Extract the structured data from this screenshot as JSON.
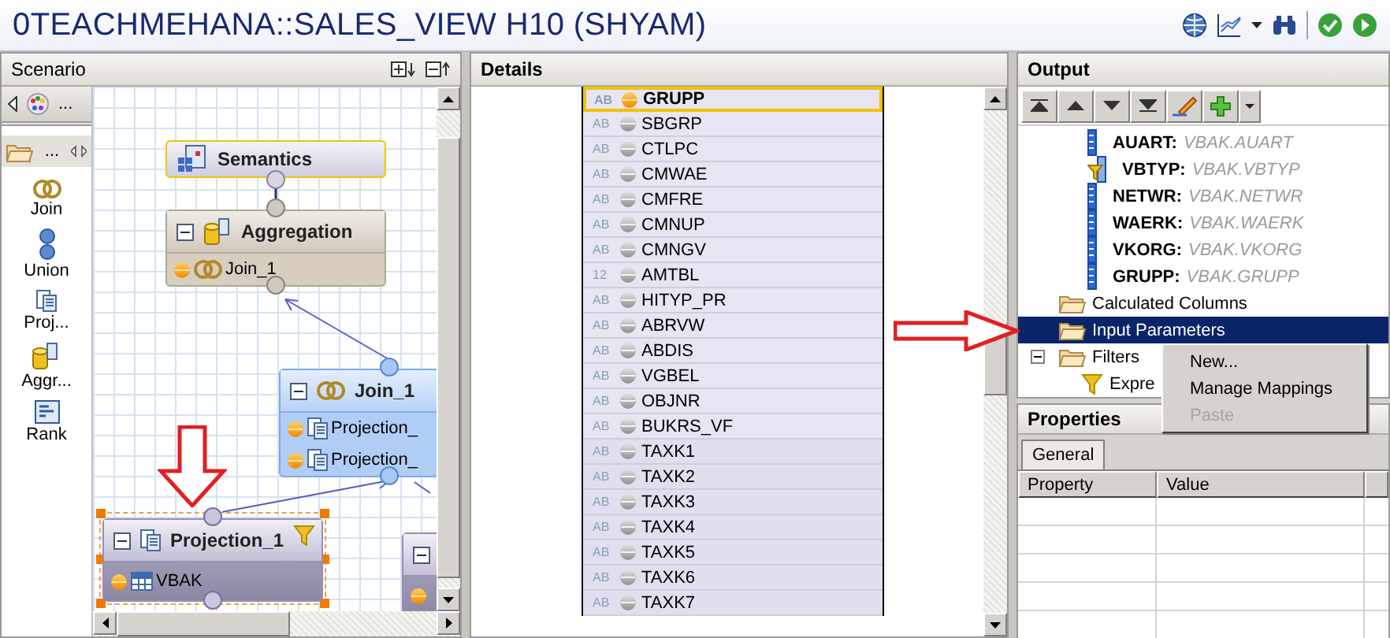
{
  "window": {
    "title": "0TEACHMEHANA::SALES_VIEW H10 (SHYAM)"
  },
  "scenario": {
    "title": "Scenario",
    "palette": {
      "top_label": "...",
      "folder_label": "...",
      "items": [
        {
          "label": "Join",
          "kind": "join"
        },
        {
          "label": "Union",
          "kind": "union"
        },
        {
          "label": "Proj...",
          "kind": "projection"
        },
        {
          "label": "Aggr...",
          "kind": "aggregation"
        },
        {
          "label": "Rank",
          "kind": "rank"
        }
      ]
    },
    "nodes": [
      {
        "kind": "semantics",
        "title": "Semantics",
        "selected": false
      },
      {
        "kind": "aggregation",
        "title": "Aggregation",
        "selected": false,
        "inputs": [
          {
            "kind": "join",
            "label": "Join_1"
          }
        ]
      },
      {
        "kind": "join",
        "title": "Join_1",
        "selected": false,
        "inputs": [
          {
            "kind": "projection",
            "label": "Projection_"
          },
          {
            "kind": "projection",
            "label": "Projection_"
          }
        ]
      },
      {
        "kind": "projection",
        "title": "Projection_1",
        "selected": true,
        "filtered": true,
        "inputs": [
          {
            "kind": "table",
            "label": "VBAK"
          }
        ]
      },
      {
        "kind": "projection",
        "selected": false,
        "inputs": [
          {
            "kind": "blank"
          }
        ]
      }
    ]
  },
  "details": {
    "title": "Details",
    "fields": [
      {
        "type": "AB",
        "name": "GRUPP",
        "selected": true
      },
      {
        "type": "AB",
        "name": "SBGRP",
        "selected": false
      },
      {
        "type": "AB",
        "name": "CTLPC",
        "selected": false
      },
      {
        "type": "AB",
        "name": "CMWAE",
        "selected": false
      },
      {
        "type": "AB",
        "name": "CMFRE",
        "selected": false
      },
      {
        "type": "AB",
        "name": "CMNUP",
        "selected": false
      },
      {
        "type": "AB",
        "name": "CMNGV",
        "selected": false
      },
      {
        "type": "12",
        "name": "AMTBL",
        "selected": false
      },
      {
        "type": "AB",
        "name": "HITYP_PR",
        "selected": false
      },
      {
        "type": "AB",
        "name": "ABRVW",
        "selected": false
      },
      {
        "type": "AB",
        "name": "ABDIS",
        "selected": false
      },
      {
        "type": "AB",
        "name": "VGBEL",
        "selected": false
      },
      {
        "type": "AB",
        "name": "OBJNR",
        "selected": false
      },
      {
        "type": "AB",
        "name": "BUKRS_VF",
        "selected": false
      },
      {
        "type": "AB",
        "name": "TAXK1",
        "selected": false
      },
      {
        "type": "AB",
        "name": "TAXK2",
        "selected": false
      },
      {
        "type": "AB",
        "name": "TAXK3",
        "selected": false
      },
      {
        "type": "AB",
        "name": "TAXK4",
        "selected": false
      },
      {
        "type": "AB",
        "name": "TAXK5",
        "selected": false
      },
      {
        "type": "AB",
        "name": "TAXK6",
        "selected": false
      },
      {
        "type": "AB",
        "name": "TAXK7",
        "selected": false
      }
    ]
  },
  "output": {
    "title": "Output",
    "columns": [
      {
        "kind": "attribute",
        "name": "AUART:",
        "source": "VBAK.AUART"
      },
      {
        "kind": "filtered",
        "name": "VBTYP:",
        "source": "VBAK.VBTYP"
      },
      {
        "kind": "attribute",
        "name": "NETWR:",
        "source": "VBAK.NETWR"
      },
      {
        "kind": "attribute",
        "name": "WAERK:",
        "source": "VBAK.WAERK"
      },
      {
        "kind": "attribute",
        "name": "VKORG:",
        "source": "VBAK.VKORG"
      },
      {
        "kind": "attribute",
        "name": "GRUPP:",
        "source": "VBAK.GRUPP"
      }
    ],
    "folders": [
      {
        "label": "Calculated Columns",
        "selected": false
      },
      {
        "label": "Input Parameters",
        "selected": true
      },
      {
        "label": "Filters",
        "selected": false,
        "expanded": true,
        "children": [
          {
            "label": "Expre"
          }
        ]
      }
    ]
  },
  "context_menu": [
    {
      "label": "New...",
      "disabled": false
    },
    {
      "label": "Manage Mappings",
      "disabled": false
    },
    {
      "label": "Paste",
      "disabled": true
    }
  ],
  "properties": {
    "title": "Properties",
    "tabs": [
      {
        "label": "General",
        "selected": true
      }
    ],
    "columns": [
      "Property",
      "Value"
    ]
  }
}
